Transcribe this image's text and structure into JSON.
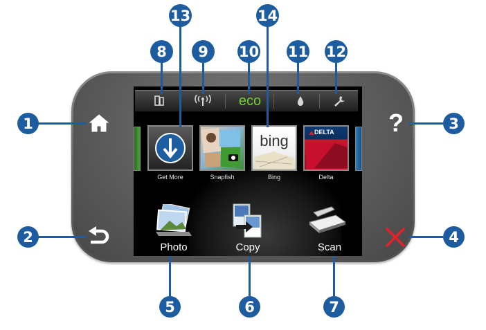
{
  "callouts": [
    "1",
    "2",
    "3",
    "4",
    "5",
    "6",
    "7",
    "8",
    "9",
    "10",
    "11",
    "12",
    "13",
    "14"
  ],
  "status_bar": {
    "eco_label": "eco",
    "icons": [
      "ink-cartridge-icon",
      "wireless-icon",
      "eco-icon",
      "ink-drop-icon",
      "wrench-icon"
    ]
  },
  "apps": [
    {
      "label": "Get More",
      "icon": "download-arrow-icon"
    },
    {
      "label": "Snapfish",
      "icon": "snapfish-icon"
    },
    {
      "label": "Bing",
      "icon": "bing-icon",
      "logo_text": "bing"
    },
    {
      "label": "Delta",
      "icon": "delta-icon",
      "logo_text": "DELTA"
    }
  ],
  "actions": [
    {
      "label": "Photo",
      "icon": "photo-icon"
    },
    {
      "label": "Copy",
      "icon": "copy-icon"
    },
    {
      "label": "Scan",
      "icon": "scanner-icon"
    }
  ],
  "hard_buttons": [
    {
      "icon": "home-icon"
    },
    {
      "icon": "back-arrow-icon"
    },
    {
      "icon": "help-icon",
      "glyph": "?"
    },
    {
      "icon": "cancel-icon"
    }
  ],
  "colors": {
    "callout": "#1d5c9e",
    "eco": "#6fd12b",
    "cancel": "#e8202a",
    "bezel": "#6a6a6a"
  }
}
